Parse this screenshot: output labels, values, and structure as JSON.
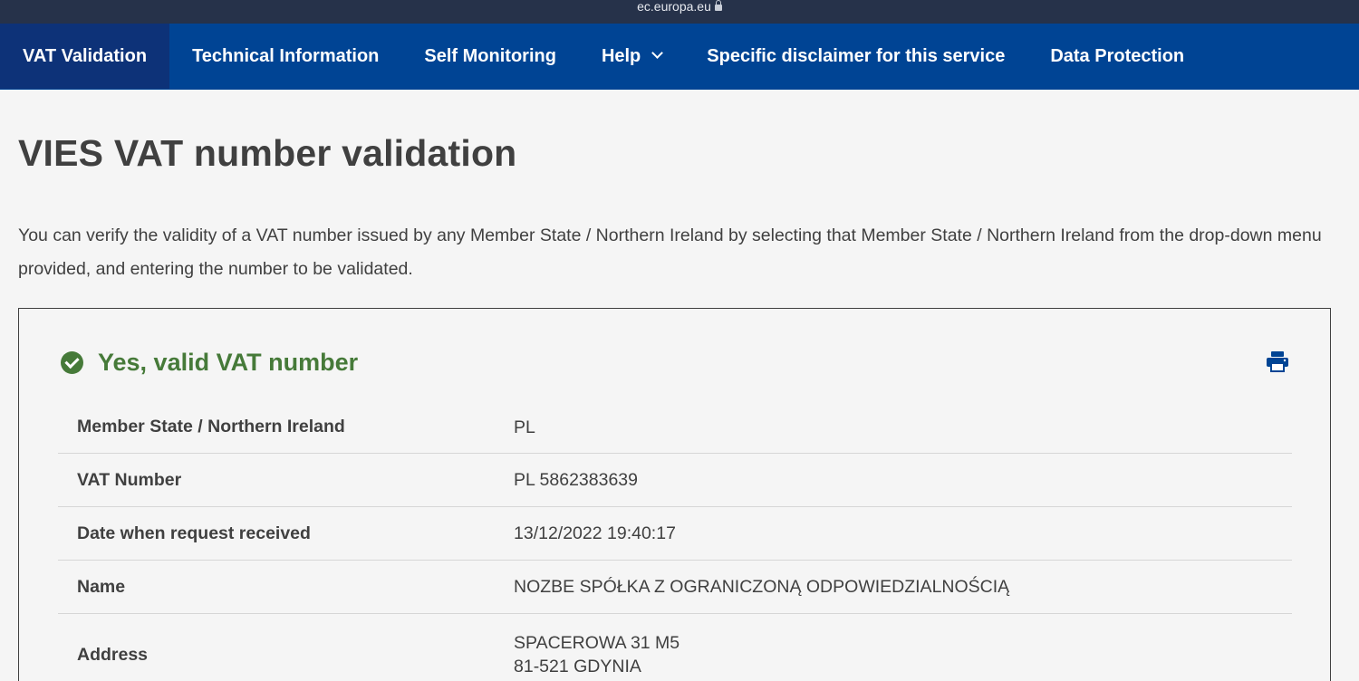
{
  "browser": {
    "url": "ec.europa.eu"
  },
  "nav": {
    "items": [
      {
        "label": "VAT Validation"
      },
      {
        "label": "Technical Information"
      },
      {
        "label": "Self Monitoring"
      },
      {
        "label": "Help"
      },
      {
        "label": "Specific disclaimer for this service"
      },
      {
        "label": "Data Protection"
      }
    ]
  },
  "page": {
    "title": "VIES VAT number validation",
    "intro": "You can verify the validity of a VAT number issued by any Member State / Northern Ireland by selecting that Member State / Northern Ireland from the drop-down menu provided, and entering the number to be validated."
  },
  "result": {
    "status": "Yes, valid VAT number",
    "status_color": "#467a39",
    "print_icon": "print-icon",
    "rows": [
      {
        "label": "Member State / Northern Ireland",
        "value": "PL"
      },
      {
        "label": "VAT Number",
        "value": "PL 5862383639"
      },
      {
        "label": "Date when request received",
        "value": "13/12/2022 19:40:17"
      },
      {
        "label": "Name",
        "value": "NOZBE SPÓŁKA Z OGRANICZONĄ ODPOWIEDZIALNOŚCIĄ"
      },
      {
        "label": "Address",
        "value": "SPACEROWA 31 M5\n81-521 GDYNIA"
      }
    ]
  },
  "colors": {
    "nav_bg": "#004494",
    "nav_active": "#0d3278",
    "urlbar_bg": "#26324a",
    "text": "#404040"
  }
}
